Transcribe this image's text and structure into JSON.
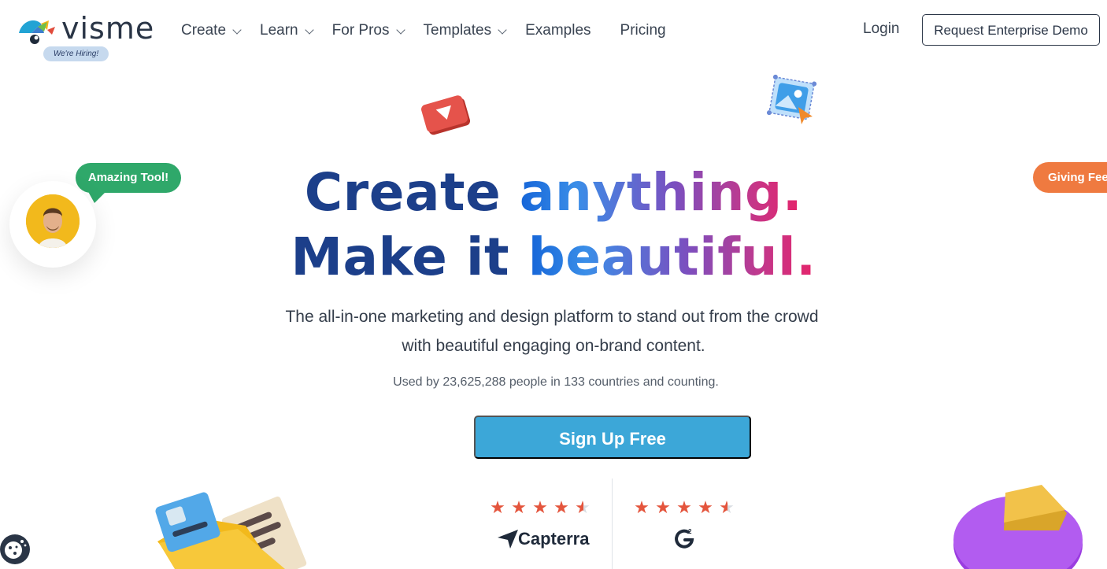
{
  "header": {
    "logo_text": "visme",
    "hiring_badge": "We're Hiring!",
    "nav": [
      {
        "label": "Create",
        "has_dropdown": true
      },
      {
        "label": "Learn",
        "has_dropdown": true
      },
      {
        "label": "For Pros",
        "has_dropdown": true
      },
      {
        "label": "Templates",
        "has_dropdown": true
      },
      {
        "label": "Examples",
        "has_dropdown": false
      },
      {
        "label": "Pricing",
        "has_dropdown": false
      }
    ],
    "login_label": "Login",
    "demo_button": "Request Enterprise Demo"
  },
  "hero": {
    "line1_part1": "Create ",
    "line1_part2": "anything.",
    "line2_part1": "Make it ",
    "line2_part2": "beautiful.",
    "subtitle_line1": "The all-in-one marketing and design platform to stand out from the crowd",
    "subtitle_line2": "with beautiful engaging on-brand content.",
    "usage_text": "Used by 23,625,288 people in 133 countries and counting.",
    "cta_button": "Sign Up Free"
  },
  "decorations": {
    "green_bubble": "Amazing Tool!",
    "orange_bubble": "Giving Feedback",
    "icons": [
      "play-icon",
      "image-edit-icon",
      "avatar-photo",
      "folder-illustration",
      "pie-chart-illustration",
      "cookie-icon"
    ]
  },
  "ratings": [
    {
      "source": "Capterra",
      "stars": 4.5
    },
    {
      "source": "G2",
      "stars": 4.5
    }
  ],
  "colors": {
    "cta": "#3ca7d8",
    "heading_dark": "#1c3f8a",
    "bubble_green": "#2fa86a",
    "bubble_orange": "#ef7a40",
    "star": "#e4553d"
  }
}
